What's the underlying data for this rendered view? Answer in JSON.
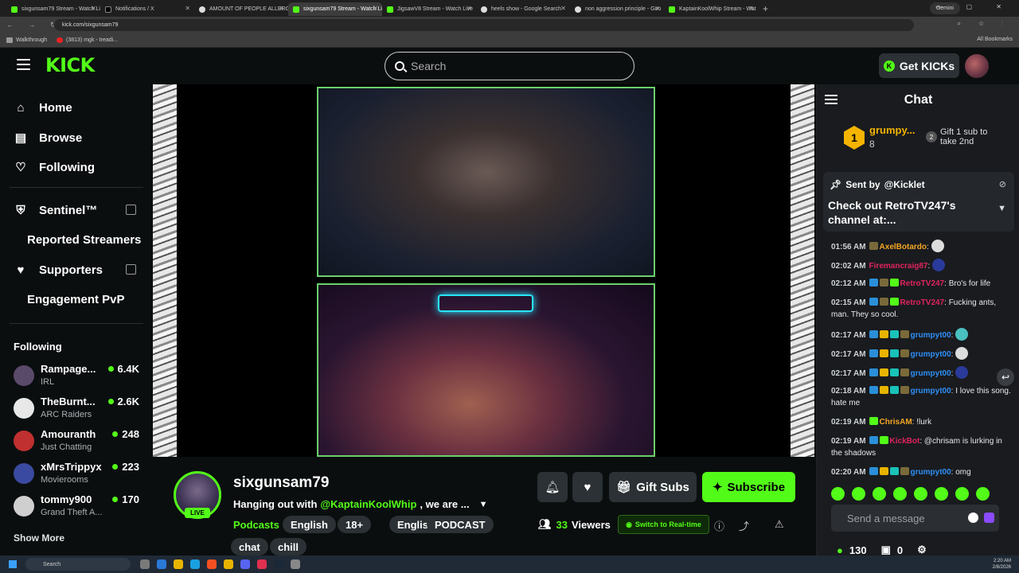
{
  "browser": {
    "tabs": [
      {
        "title": "sixgunsam79 Stream - Watch Live",
        "active": false,
        "fav": "kick"
      },
      {
        "title": "Notifications / X",
        "active": false,
        "fav": "x"
      },
      {
        "title": "AMOUNT OF PEOPLE ALLERGIC",
        "active": false,
        "fav": "g"
      },
      {
        "title": "sixgunsam79 Stream - Watch Li",
        "active": true,
        "fav": "kick"
      },
      {
        "title": "JigsawV8 Stream - Watch Live",
        "active": false,
        "fav": "kick"
      },
      {
        "title": "heels show - Google Search",
        "active": false,
        "fav": "g"
      },
      {
        "title": "non aggression principle - Goo",
        "active": false,
        "fav": "g"
      },
      {
        "title": "KaptainKoolWhip Stream - Wat",
        "active": false,
        "fav": "kick"
      }
    ],
    "gemini_label": "Gemini",
    "url": "kick.com/sixgunsam79",
    "bookmarks": [
      "Walkthrough",
      "(3813) mgk - treadi..."
    ],
    "all_bookmarks": "All Bookmarks"
  },
  "header": {
    "logo": "KICK",
    "search_placeholder": "Search",
    "get_kicks": "Get KICKs"
  },
  "sidebar": {
    "nav": [
      {
        "label": "Home",
        "icon": "home-icon"
      },
      {
        "label": "Browse",
        "icon": "browse-icon"
      },
      {
        "label": "Following",
        "icon": "heart-icon"
      }
    ],
    "sentinel": "Sentinel™",
    "reported": "Reported Streamers",
    "supporters": "Supporters",
    "engagement": "Engagement PvP",
    "following_title": "Following",
    "following": [
      {
        "name": "Rampage...",
        "category": "IRL",
        "viewers": "6.4K",
        "color": "#5a4a6a"
      },
      {
        "name": "TheBurnt...",
        "category": "ARC Raiders",
        "viewers": "2.6K",
        "color": "#e8e8e8"
      },
      {
        "name": "Amouranth",
        "category": "Just Chatting",
        "viewers": "248",
        "color": "#c03030"
      },
      {
        "name": "xMrsTrippyx",
        "category": "Movierooms",
        "viewers": "223",
        "color": "#3a4aa0"
      },
      {
        "name": "tommy900",
        "category": "Grand Theft A...",
        "viewers": "170",
        "color": "#cfcfcf"
      }
    ],
    "show_more": "Show More"
  },
  "channel": {
    "name": "sixgunsam79",
    "live_badge": "LIVE",
    "title_prefix": "Hanging out with",
    "title_mention": "@KaptainKoolWhip",
    "title_suffix": ", we are ...",
    "category": "Podcasts",
    "tags": [
      "English",
      "18+",
      "English",
      "PODCAST",
      "chat",
      "chill"
    ],
    "gift_subs": "Gift Subs",
    "subscribe": "Subscribe",
    "viewers_count": "33",
    "viewers_label": "Viewers",
    "realtime": "Switch to Real-time"
  },
  "chat": {
    "title": "Chat",
    "leader_rank": "1",
    "leader_name": "grumpy...",
    "leader_count": "8",
    "gift_rank": "2",
    "gift_text_1": "Gift 1 sub to",
    "gift_text_2": "take 2nd",
    "pinned_sent_by": "Sent by",
    "pinned_user": "@Kicklet",
    "pinned_message": "Check out RetroTV247's channel at:...",
    "messages": [
      {
        "time": "01:56 AM",
        "user": "AxelBotardo",
        "color": "#f5a623",
        "text": "",
        "badges": [
          "b-olive"
        ]
      },
      {
        "time": "02:02 AM",
        "user": "Firemancraig87",
        "color": "#e0245e",
        "text": "",
        "badges": []
      },
      {
        "time": "02:12 AM",
        "user": "RetroTV247",
        "color": "#e0245e",
        "text": "Bro's for life",
        "badges": [
          "b-blue",
          "b-olive",
          "b-green"
        ]
      },
      {
        "time": "02:15 AM",
        "user": "RetroTV247",
        "color": "#e0245e",
        "text": "Fucking ants, man. They so cool.",
        "badges": [
          "b-blue",
          "b-olive",
          "b-green"
        ]
      },
      {
        "time": "02:17 AM",
        "user": "grumpyt00",
        "color": "#2f8ff5",
        "text": "",
        "badges": [
          "b-blue",
          "b-gold",
          "b-teal",
          "b-olive"
        ]
      },
      {
        "time": "02:17 AM",
        "user": "grumpyt00",
        "color": "#2f8ff5",
        "text": "",
        "badges": [
          "b-blue",
          "b-gold",
          "b-teal",
          "b-olive"
        ]
      },
      {
        "time": "02:17 AM",
        "user": "grumpyt00",
        "color": "#2f8ff5",
        "text": "",
        "badges": [
          "b-blue",
          "b-gold",
          "b-teal",
          "b-olive"
        ]
      },
      {
        "time": "02:18 AM",
        "user": "grumpyt00",
        "color": "#2f8ff5",
        "text": "I love this song. hate me",
        "badges": [
          "b-blue",
          "b-gold",
          "b-teal",
          "b-olive"
        ]
      },
      {
        "time": "02:19 AM",
        "user": "ChrisAM",
        "color": "#f5a623",
        "text": "!lurk",
        "badges": [
          "b-green"
        ]
      },
      {
        "time": "02:19 AM",
        "user": "KickBot",
        "color": "#e0245e",
        "text": "@chrisam is lurking in the shadows",
        "badges": [
          "b-blue",
          "b-green"
        ]
      },
      {
        "time": "02:20 AM",
        "user": "grumpyt00",
        "color": "#2f8ff5",
        "text": "omg",
        "badges": [
          "b-blue",
          "b-gold",
          "b-teal",
          "b-olive"
        ]
      }
    ],
    "hover_tooltip": "grumpyt00",
    "send_placeholder": "Send a message",
    "footer_kicks": "130",
    "footer_count": "0"
  },
  "taskbar": {
    "search": "Search",
    "time": "2:20 AM",
    "date": "2/8/2026"
  }
}
